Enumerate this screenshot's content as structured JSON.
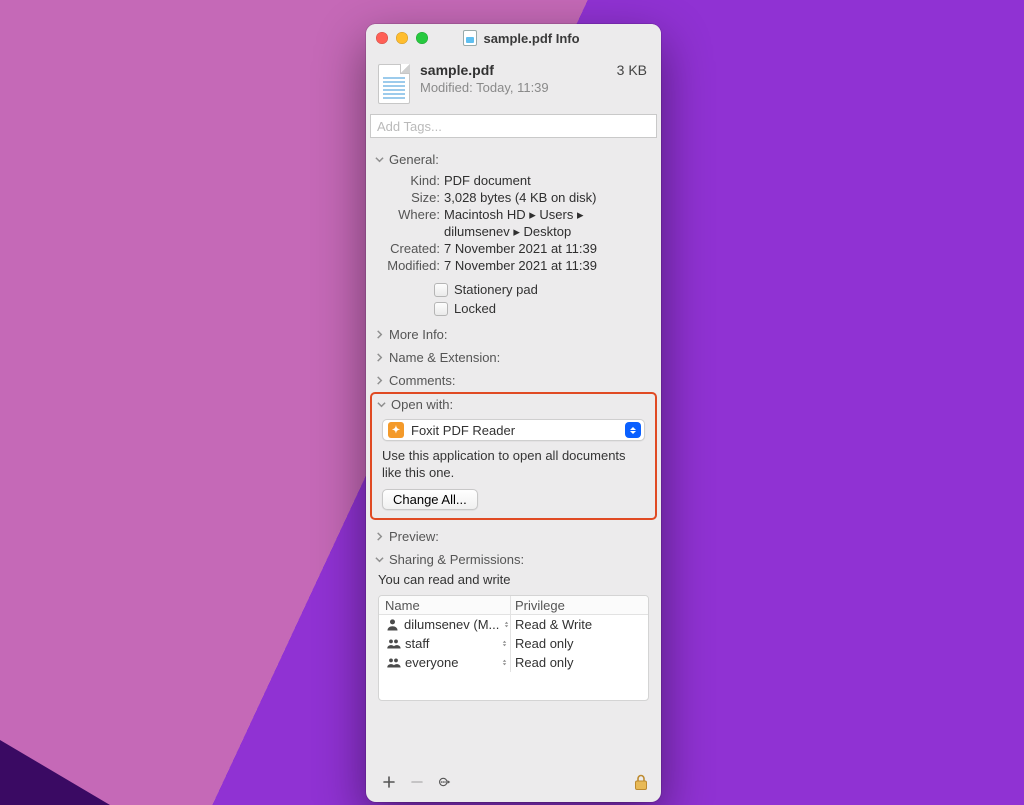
{
  "window": {
    "title": "sample.pdf Info"
  },
  "summary": {
    "filename": "sample.pdf",
    "modified_line": "Modified:  Today, 11:39",
    "size_short": "3 KB"
  },
  "tags": {
    "placeholder": "Add Tags..."
  },
  "sections": {
    "general": {
      "title": "General:"
    },
    "more_info": {
      "title": "More Info:"
    },
    "name_ext": {
      "title": "Name & Extension:"
    },
    "comments": {
      "title": "Comments:"
    },
    "open_with": {
      "title": "Open with:"
    },
    "preview": {
      "title": "Preview:"
    },
    "sharing": {
      "title": "Sharing & Permissions:"
    }
  },
  "general": {
    "kind_label": "Kind:",
    "kind": "PDF document",
    "size_label": "Size:",
    "size": "3,028 bytes (4 KB on disk)",
    "where_label": "Where:",
    "where": "Macintosh HD ▸ Users ▸ dilumsenev ▸ Desktop",
    "created_label": "Created:",
    "created": "7 November 2021 at 11:39",
    "modified_label": "Modified:",
    "modified": "7 November 2021 at 11:39",
    "stationery_label": "Stationery pad",
    "locked_label": "Locked"
  },
  "open_with": {
    "app": "Foxit PDF Reader",
    "desc": "Use this application to open all documents like this one.",
    "change_all": "Change All..."
  },
  "sharing": {
    "you_can": "You can read and write",
    "headers": {
      "name": "Name",
      "privilege": "Privilege"
    },
    "rows": [
      {
        "icon": "person",
        "name": "dilumsenev (M...",
        "priv": "Read & Write"
      },
      {
        "icon": "group",
        "name": "staff",
        "priv": "Read only"
      },
      {
        "icon": "group",
        "name": "everyone",
        "priv": "Read only"
      }
    ]
  }
}
